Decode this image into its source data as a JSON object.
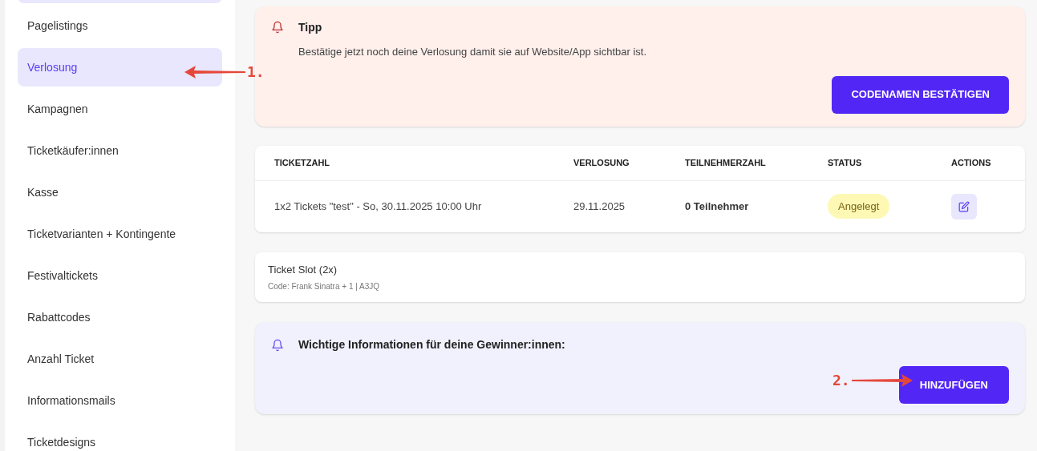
{
  "sidebar": {
    "items": [
      {
        "selected": true
      },
      {
        "label": "Pagelistings",
        "selected": false
      },
      {
        "label": "Verlosung",
        "selected": true
      },
      {
        "label": "Kampagnen",
        "selected": false
      },
      {
        "label": "Ticketkäufer:innen",
        "selected": false
      },
      {
        "label": "Kasse",
        "selected": false
      },
      {
        "label": "Ticketvarianten + Kontingente",
        "selected": false
      },
      {
        "label": "Festivaltickets",
        "selected": false
      },
      {
        "label": "Rabattcodes",
        "selected": false
      },
      {
        "label": "Anzahl Ticket",
        "selected": false
      },
      {
        "label": "Informationsmails",
        "selected": false
      },
      {
        "label": "Ticketdesigns",
        "selected": false
      }
    ]
  },
  "tip": {
    "title": "Tipp",
    "text": "Bestätige jetzt noch deine Verlosung damit sie auf Website/App sichtbar ist.",
    "button": "CODENAMEN BESTÄTIGEN"
  },
  "table": {
    "columns": [
      "TICKETZAHL",
      "VERLOSUNG",
      "TEILNEHMERZAHL",
      "STATUS",
      "ACTIONS"
    ],
    "rows": [
      {
        "ticket": "1x2 Tickets \"test\" - So, 30.11.2025 10:00 Uhr",
        "date": "29.11.2025",
        "participants": "0 Teilnehmer",
        "status": "Angelegt"
      }
    ]
  },
  "slot": {
    "title": "Ticket Slot (2x)",
    "code": "Code: Frank Sinatra + 1 | A3JQ"
  },
  "info": {
    "title": "Wichtige Informationen für deine Gewinner:innen:",
    "button": "HINZUFÜGEN"
  },
  "annotations": [
    {
      "label": "1."
    },
    {
      "label": "2."
    }
  ]
}
